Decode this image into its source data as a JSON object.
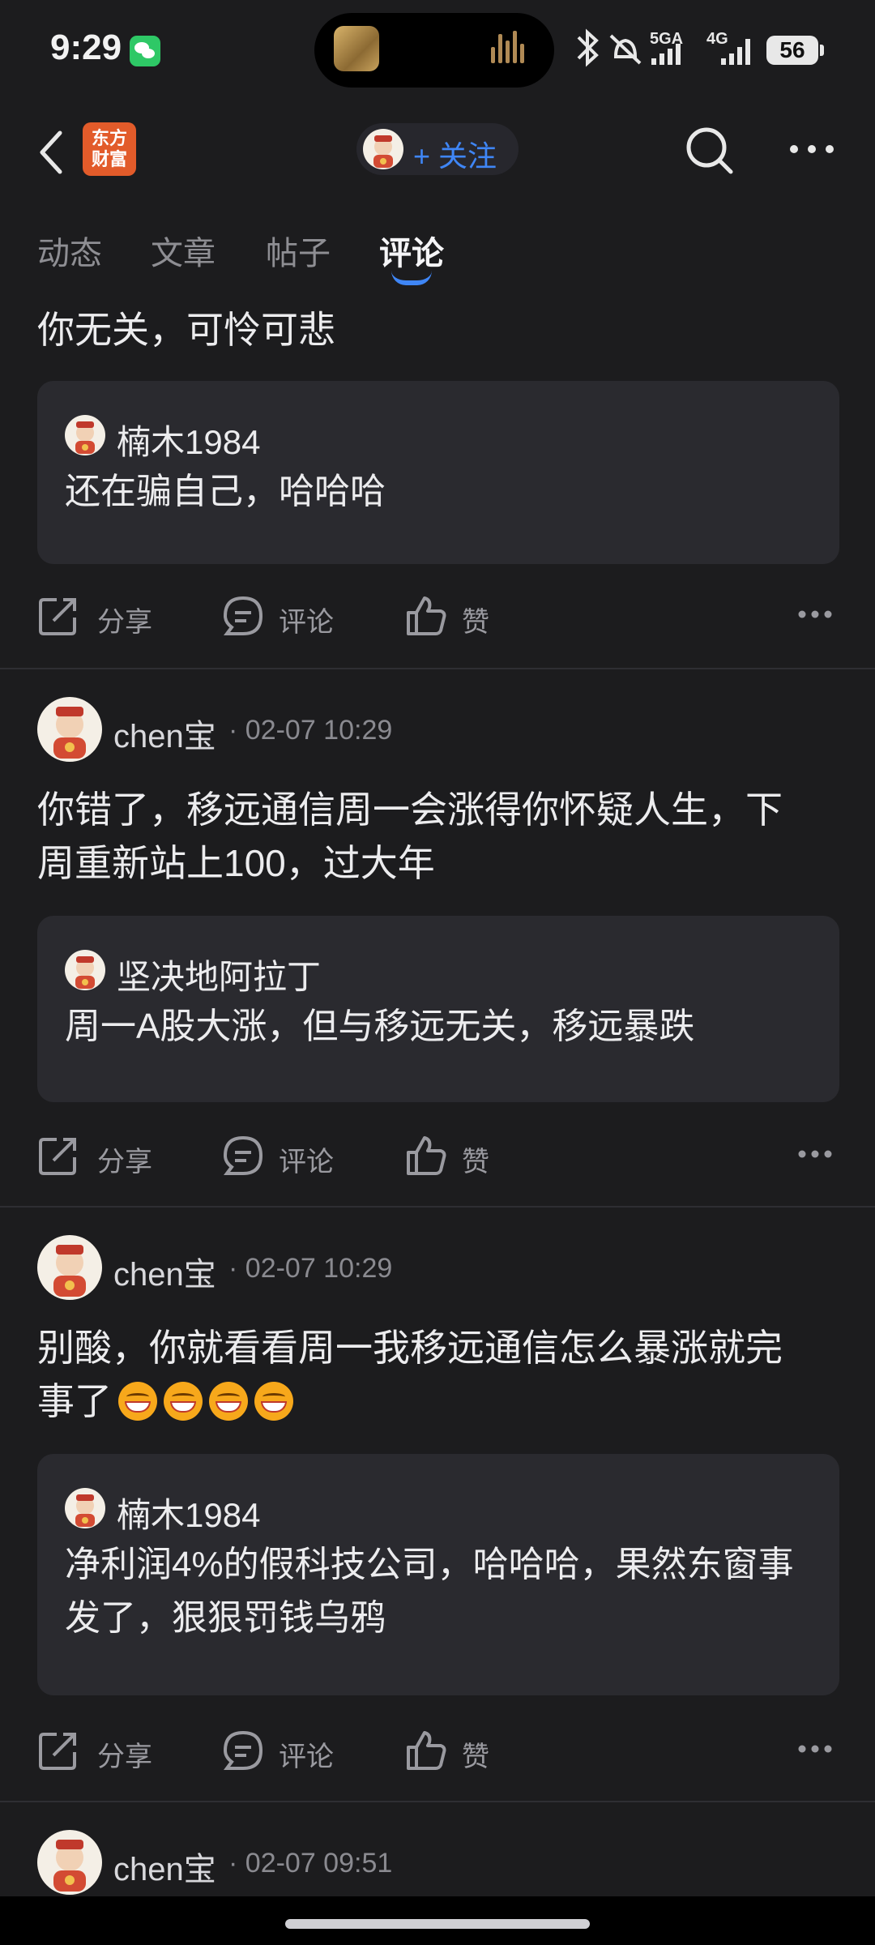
{
  "status_bar": {
    "time": "9:29",
    "network_1": "5GA",
    "network_2": "4G",
    "battery": "56"
  },
  "header": {
    "logo_text_line1": "东方",
    "logo_text_line2": "财富",
    "follow_label": "+ 关注"
  },
  "tabs": [
    {
      "label": "动态"
    },
    {
      "label": "文章"
    },
    {
      "label": "帖子"
    },
    {
      "label": "评论",
      "active": true
    }
  ],
  "actions": {
    "share": "分享",
    "comment": "评论",
    "like": "赞"
  },
  "posts": [
    {
      "text_lines": [
        "你无关，可怜可悲"
      ],
      "quote": {
        "user": "楠木1984",
        "text": "还在骗自己，哈哈哈"
      }
    },
    {
      "user": "chen宝",
      "time": "02-07 10:29",
      "text_lines": [
        "你错了，移远通信周一会涨得你怀疑人生，下",
        "周重新站上100，过大年"
      ],
      "quote": {
        "user": "坚决地阿拉丁",
        "text": "周一A股大涨，但与移远无关，移远暴跌"
      }
    },
    {
      "user": "chen宝",
      "time": "02-07 10:29",
      "text_lines": [
        "别酸，你就看看周一我移远通信怎么暴涨就完",
        "事了"
      ],
      "quote": {
        "user": "楠木1984",
        "text_lines": [
          "净利润4%的假科技公司，哈哈哈，果然东窗事",
          "发了，狠狠罚钱乌鸦"
        ]
      }
    },
    {
      "user": "chen宝",
      "time": "02-07 09:51"
    }
  ],
  "colors": {
    "background": "#1c1c1e",
    "card": "#2a2a2f",
    "accent": "#3f86f6",
    "text": "#ececee",
    "muted": "#8a8a90"
  }
}
